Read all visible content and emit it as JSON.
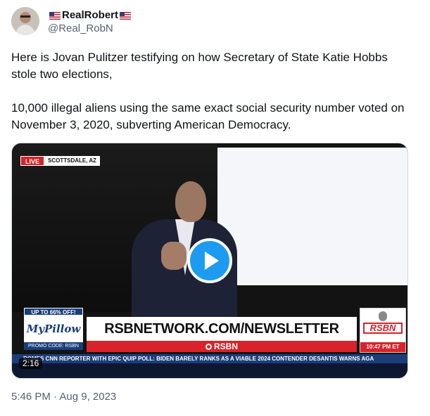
{
  "author": {
    "display_name": "RealRobert",
    "handle": "@Real_RobN"
  },
  "tweet": {
    "text": "Here is Jovan Pulitzer testifying on how Secretary of State Katie Hobbs stole two elections,\n\n10,000 illegal aliens using the same exact social security number voted on November 3, 2020, subverting American Democracy.",
    "posted": "5:46 PM · Aug 9, 2023"
  },
  "video": {
    "duration": "2:16",
    "live_label": "LIVE",
    "location": "SCOTTSDALE, AZ",
    "promo_top": "UP TO 66% OFF!",
    "promo_logo": "MyPillow",
    "promo_code": "PROMO CODE: RSBN",
    "banner": "RSBNETWORK.COM/NEWSLETTER",
    "banner_sub": "RSBN",
    "channel_logo": "RSBN",
    "clock": "10:47 PM ET",
    "ticker": "ROMES CNN REPORTER WITH EPIC QUIP     POLL: BIDEN BARELY RANKS AS A VIABLE 2024 CONTENDER     DESANTIS WARNS AGA"
  },
  "colors": {
    "play_button": "#1d9bf0",
    "accent_red": "#d8232a",
    "ticker_blue": "#1a3e7a"
  }
}
